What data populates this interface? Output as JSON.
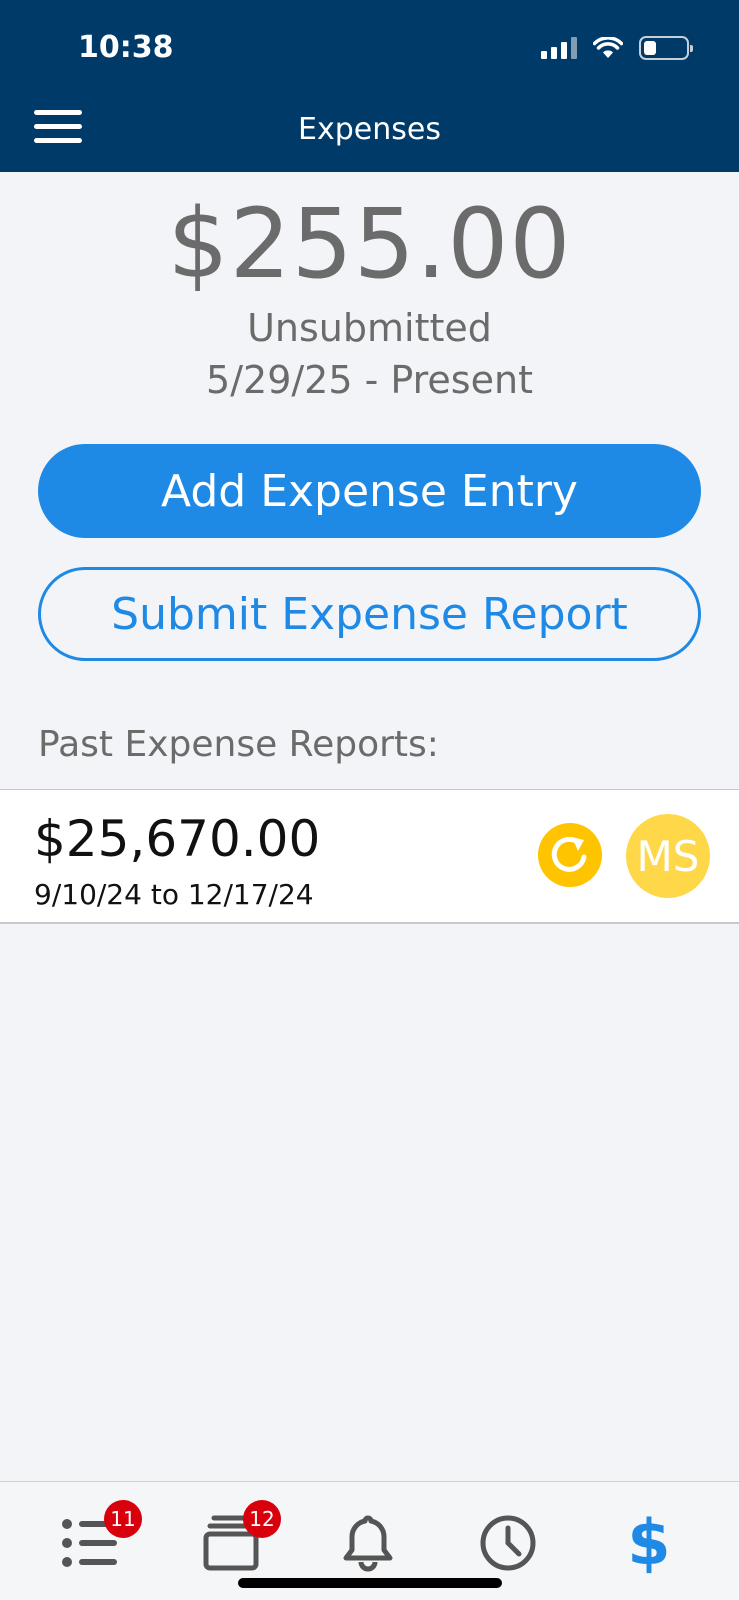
{
  "status_bar": {
    "time": "10:38",
    "battery_level": 0.3,
    "icons": [
      "cellular-signal-icon",
      "wifi-icon",
      "battery-icon"
    ]
  },
  "header": {
    "title": "Expenses",
    "menu_icon": "hamburger-menu-icon",
    "background_color": "#003a68"
  },
  "summary": {
    "amount": "$255.00",
    "status": "Unsubmitted",
    "date_range": "5/29/25 - Present"
  },
  "actions": {
    "add_label": "Add Expense Entry",
    "submit_label": "Submit Expense Report",
    "accent_color": "#1e8ae6"
  },
  "past_reports": {
    "label": "Past Expense Reports:",
    "items": [
      {
        "amount": "$25,670.00",
        "date_range": "9/10/24 to 12/17/24",
        "status_icon": "pending-refresh-icon",
        "status_color": "#ffc400",
        "approver_initials": "MS",
        "avatar_color": "#ffd84a"
      }
    ]
  },
  "bottom_nav": {
    "items": [
      {
        "icon": "task-list-icon",
        "badge": "11"
      },
      {
        "icon": "cards-stack-icon",
        "badge": "12"
      },
      {
        "icon": "bell-icon"
      },
      {
        "icon": "clock-icon"
      },
      {
        "icon": "dollar-icon",
        "glyph": "$",
        "active": true
      }
    ],
    "badge_color": "#d9000d"
  }
}
